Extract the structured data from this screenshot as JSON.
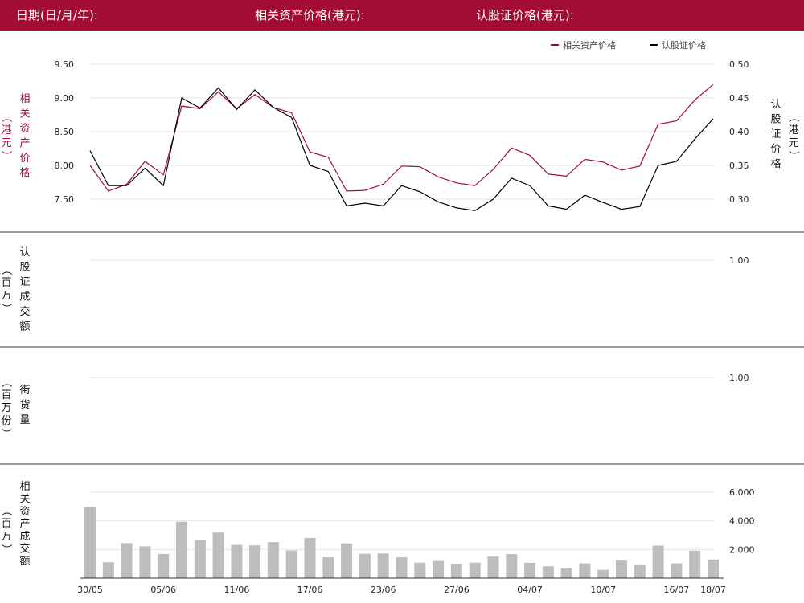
{
  "header": {
    "date_label": "日期(日/月/年):",
    "asset_price_label": "相关资产价格(港元):",
    "warrant_price_label": "认股证价格(港元):"
  },
  "colors": {
    "brand": "#a30d33",
    "asset_line": "#a30d33",
    "warrant_line": "#000000",
    "bar": "#bdbdbd",
    "grid": "#e6e6e6",
    "divider": "#333333"
  },
  "chart_data": [
    {
      "type": "line",
      "panel": "price",
      "left_axis_label": "相关资产价格（港元）",
      "right_axis_label": "认股证价格（港元）",
      "left_ticks": [
        "7.50",
        "8.00",
        "8.50",
        "9.00",
        "9.50"
      ],
      "right_ticks": [
        "0.30",
        "0.35",
        "0.40",
        "0.45",
        "0.50"
      ],
      "left_ylim": [
        7.2,
        9.6
      ],
      "right_ylim": [
        0.27,
        0.51
      ],
      "legend": [
        {
          "name": "相关资产价格",
          "color": "#a30d33"
        },
        {
          "name": "认股证价格",
          "color": "#000000"
        }
      ],
      "series": [
        {
          "name": "相关资产价格",
          "axis": "left",
          "values": [
            8.0,
            7.62,
            7.72,
            8.06,
            7.86,
            8.88,
            8.84,
            9.09,
            8.84,
            9.05,
            8.86,
            8.78,
            8.2,
            8.12,
            7.62,
            7.63,
            7.72,
            7.99,
            7.98,
            7.83,
            7.74,
            7.7,
            7.94,
            8.26,
            8.15,
            7.87,
            7.84,
            8.09,
            8.05,
            7.93,
            7.99,
            8.61,
            8.66,
            8.97,
            9.2
          ]
        },
        {
          "name": "认股证价格",
          "axis": "right",
          "values": [
            0.372,
            0.32,
            0.32,
            0.346,
            0.32,
            0.45,
            0.435,
            0.465,
            0.433,
            0.462,
            0.436,
            0.421,
            0.35,
            0.341,
            0.29,
            0.294,
            0.29,
            0.32,
            0.311,
            0.296,
            0.287,
            0.283,
            0.3,
            0.331,
            0.32,
            0.29,
            0.285,
            0.306,
            0.295,
            0.285,
            0.289,
            0.35,
            0.356,
            0.389,
            0.419
          ]
        }
      ]
    },
    {
      "type": "bar",
      "panel": "warrant_turnover",
      "left_axis_label": "认股证成交额（百万）",
      "right_ticks": [
        "1.00"
      ],
      "values": []
    },
    {
      "type": "bar",
      "panel": "outstanding",
      "left_axis_label": "街货量（百万份）",
      "right_ticks": [
        "1.00"
      ],
      "values": []
    },
    {
      "type": "bar",
      "panel": "asset_turnover",
      "left_axis_label": "相关资产成交额（百万）",
      "right_ticks": [
        "2,000",
        "4,000",
        "6,000"
      ],
      "ylim": [
        0,
        6000
      ],
      "tick_values": [
        2000,
        4000,
        6000
      ],
      "values": [
        4970,
        1110,
        2450,
        2220,
        1690,
        3940,
        2680,
        3190,
        2320,
        2290,
        2520,
        1930,
        2810,
        1450,
        2430,
        1700,
        1720,
        1460,
        1080,
        1200,
        970,
        1080,
        1510,
        1680,
        1070,
        830,
        680,
        1040,
        580,
        1230,
        910,
        2270,
        1030,
        1920,
        1300
      ]
    }
  ],
  "x_axis": {
    "tick_labels": [
      "30/05",
      "05/06",
      "11/06",
      "17/06",
      "23/06",
      "27/06",
      "04/07",
      "10/07",
      "16/07",
      "18/07"
    ],
    "tick_indices": [
      0,
      4,
      8,
      12,
      16,
      20,
      24,
      28,
      32,
      34
    ]
  }
}
